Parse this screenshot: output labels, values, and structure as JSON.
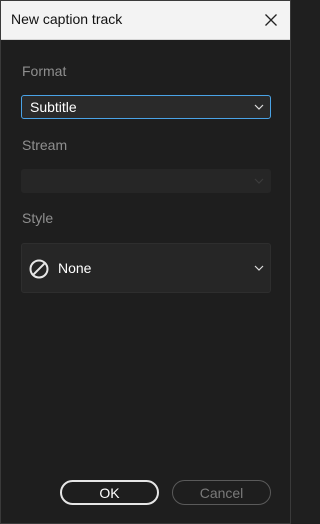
{
  "window": {
    "title": "New caption track"
  },
  "form": {
    "format_label": "Format",
    "format_value": "Subtitle",
    "stream_label": "Stream",
    "stream_value": "",
    "style_label": "Style",
    "style_value": "None",
    "style_icon": "none-circle-slash-icon"
  },
  "buttons": {
    "ok_label": "OK",
    "cancel_label": "Cancel"
  },
  "colors": {
    "focus_border": "#4aa3e6",
    "background": "#1e1e1e",
    "titlebar": "#f3f3f3"
  }
}
